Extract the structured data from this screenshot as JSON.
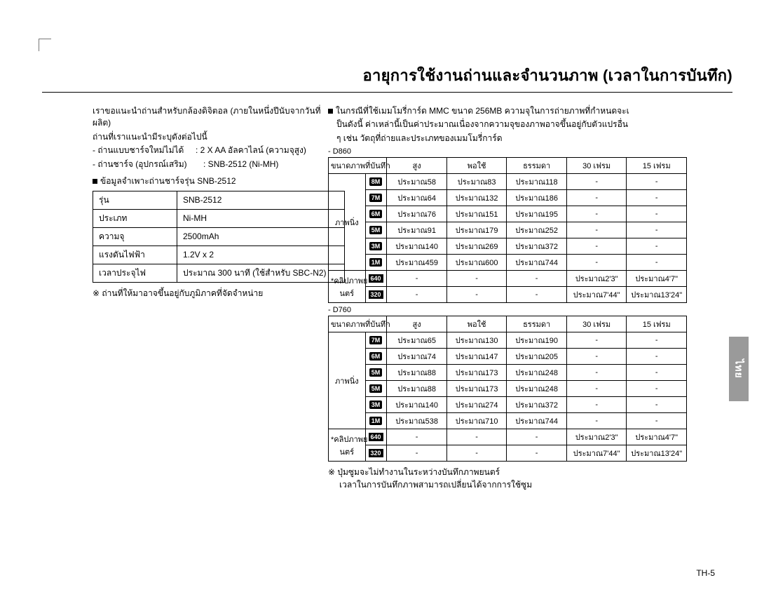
{
  "title": "อายุการใช้งานถ่านและจำนวนภาพ (เวลาในการบันทึก)",
  "left": {
    "p1": "เราขอแนะนำถ่านสำหรับกล้องดิจิตอล (ภายในหนึ่งปีนับจากวันที่ผลิต)",
    "p2": "ถ่านที่เราแนะนำมีระบุดังต่อไปนี้",
    "p3a": "- ถ่านแบบชาร์จใหม่ไม่ได้",
    "p3b": ": 2 X AA อัลคาไลน์ (ความจุสูง)",
    "p4a": "- ถ่านชาร์จ (อุปกรณ์เสริม)",
    "p4b": ": SNB-2512 (Ni-MH)",
    "spec_hdr": "ข้อมูลจำเพาะถ่านชาร์จรุ่น SNB-2512",
    "spec": {
      "r1a": "รุ่น",
      "r1b": "SNB-2512",
      "r2a": "ประเภท",
      "r2b": "Ni-MH",
      "r3a": "ความจุ",
      "r3b": "2500mAh",
      "r4a": "แรงดันไฟฟ้า",
      "r4b": "1.2V x 2",
      "r5a": "เวลาประจุไฟ",
      "r5b": "ประมาณ 300 นาที (ใช้สำหรับ SBC-N2)"
    },
    "note": "※ ถ่านที่ให้มาอาจขึ้นอยู่กับภูมิภาคที่จัดจำหน่าย"
  },
  "right": {
    "intro1": "ในกรณีที่ใช้เมมโมรี่การ์ด MMC ขนาด 256MB ความจุในการถ่ายภาพที่กำหนดจะเ",
    "intro2": "ป็นดังนี้ ค่าเหล่านี้เป็นค่าประมาณเนื่องจากความจุของภาพอาจขึ้นอยู่กับตัวแปรอื่น",
    "intro3": "ๆ เช่น วัตถุที่ถ่ายและประเภทของเมมโมรี่การ์ด",
    "model1": "- D860",
    "model2": "- D760",
    "hdr": {
      "h1": "ขนาดภาพที่บันทึก",
      "h2": "สูง",
      "h3": "พอใช้",
      "h4": "ธรรมดา",
      "h5": "30 เฟรม",
      "h6": "15 เฟรม"
    },
    "rowlabel_still": "ภาพนิ่ง",
    "rowlabel_movie": "*คลิปภาพย\nนตร์",
    "rowlabel_movie_l1": "*คลิปภาพย",
    "rowlabel_movie_l2": "นตร์",
    "d860": {
      "rows": [
        {
          "icon": "8M",
          "c": [
            "ประมาณ58",
            "ประมาณ83",
            "ประมาณ118",
            "-",
            "-"
          ]
        },
        {
          "icon": "7M",
          "c": [
            "ประมาณ64",
            "ประมาณ132",
            "ประมาณ186",
            "-",
            "-"
          ]
        },
        {
          "icon": "6M",
          "c": [
            "ประมาณ76",
            "ประมาณ151",
            "ประมาณ195",
            "-",
            "-"
          ]
        },
        {
          "icon": "5M",
          "c": [
            "ประมาณ91",
            "ประมาณ179",
            "ประมาณ252",
            "-",
            "-"
          ]
        },
        {
          "icon": "3M",
          "c": [
            "ประมาณ140",
            "ประมาณ269",
            "ประมาณ372",
            "-",
            "-"
          ]
        },
        {
          "icon": "1M",
          "c": [
            "ประมาณ459",
            "ประมาณ600",
            "ประมาณ744",
            "-",
            "-"
          ]
        }
      ],
      "mov": [
        {
          "icon": "640",
          "c": [
            "-",
            "-",
            "-",
            "ประมาณ2'3\"",
            "ประมาณ4'7\""
          ]
        },
        {
          "icon": "320",
          "c": [
            "-",
            "-",
            "-",
            "ประมาณ7'44\"",
            "ประมาณ13'24\""
          ]
        }
      ]
    },
    "d760": {
      "rows": [
        {
          "icon": "7M",
          "c": [
            "ประมาณ65",
            "ประมาณ130",
            "ประมาณ190",
            "-",
            "-"
          ]
        },
        {
          "icon": "6M",
          "c": [
            "ประมาณ74",
            "ประมาณ147",
            "ประมาณ205",
            "-",
            "-"
          ]
        },
        {
          "icon": "5M",
          "c": [
            "ประมาณ88",
            "ประมาณ173",
            "ประมาณ248",
            "-",
            "-"
          ]
        },
        {
          "icon": "5M",
          "c": [
            "ประมาณ88",
            "ประมาณ173",
            "ประมาณ248",
            "-",
            "-"
          ]
        },
        {
          "icon": "3M",
          "c": [
            "ประมาณ140",
            "ประมาณ274",
            "ประมาณ372",
            "-",
            "-"
          ]
        },
        {
          "icon": "1M",
          "c": [
            "ประมาณ538",
            "ประมาณ710",
            "ประมาณ744",
            "-",
            "-"
          ]
        }
      ],
      "mov": [
        {
          "icon": "640",
          "c": [
            "-",
            "-",
            "-",
            "ประมาณ2'3\"",
            "ประมาณ4'7\""
          ]
        },
        {
          "icon": "320",
          "c": [
            "-",
            "-",
            "-",
            "ประมาณ7'44\"",
            "ประมาณ13'24\""
          ]
        }
      ]
    },
    "foot1": "※ ปุ่มซูมจะไม่ทำงานในระหว่างบันทึกภาพยนตร์",
    "foot2": "เวลาในการบันทึกภาพสามารถเปลี่ยนได้จากการใช้ซูม"
  },
  "side_tab": "ไทย",
  "page_no": "TH-5"
}
